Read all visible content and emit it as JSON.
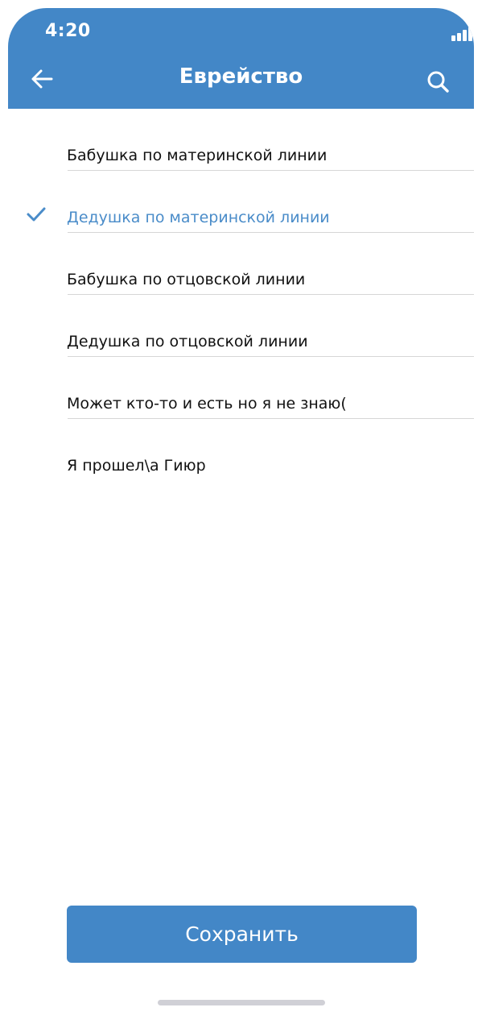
{
  "status_bar": {
    "time": "4:20",
    "icons": [
      "signal-icon",
      "wifi-icon",
      "battery-icon"
    ]
  },
  "header": {
    "title": "Еврейство",
    "back_icon": "back-arrow-icon",
    "search_icon": "search-icon",
    "color": "#4387c7"
  },
  "options": [
    {
      "label": "Бабушка по материнской линии",
      "selected": false
    },
    {
      "label": "Дедушка по материнской линии",
      "selected": true
    },
    {
      "label": "Бабушка по отцовской линии",
      "selected": false
    },
    {
      "label": "Дедушка по отцовской линии",
      "selected": false
    },
    {
      "label": "Может кто-то и есть но я не знаю(",
      "selected": false
    },
    {
      "label": "Я прошел\\а Гиюр",
      "selected": false
    }
  ],
  "colors": {
    "accent": "#4387c7",
    "selected_text": "#4a8cc9",
    "text": "#111111",
    "divider": "#d6d6d6"
  },
  "save_button": {
    "label": "Сохранить"
  }
}
